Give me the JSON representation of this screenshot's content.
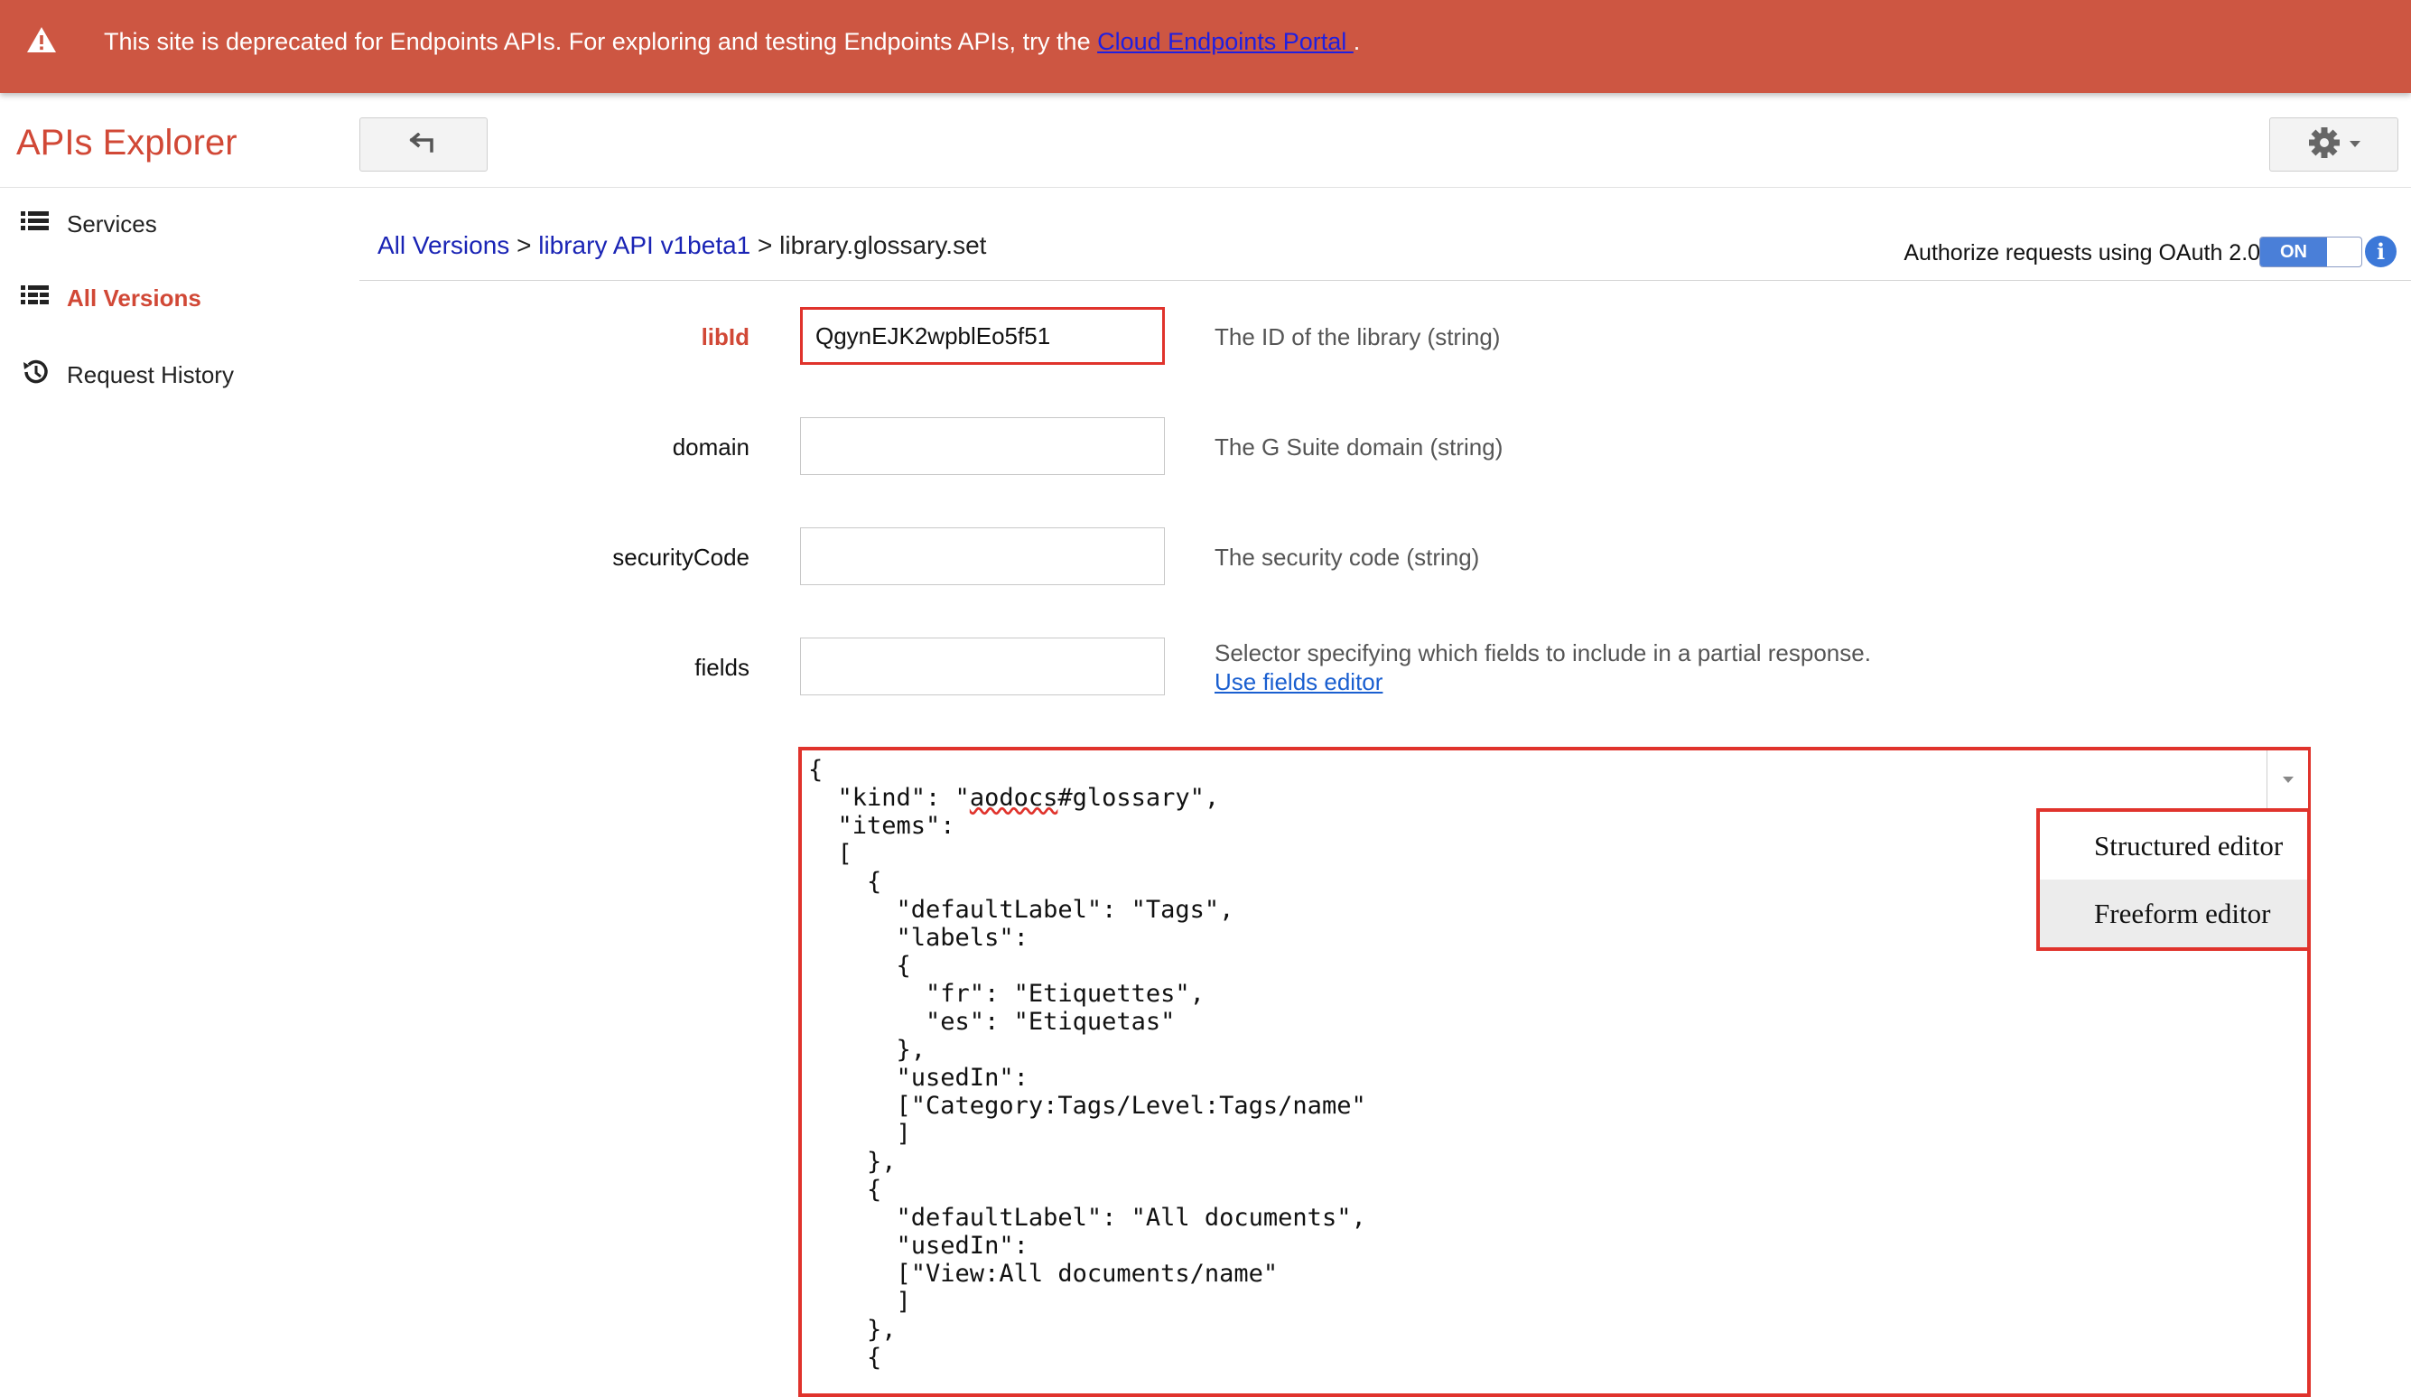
{
  "banner": {
    "message": "This site is deprecated for Endpoints APIs. For exploring and testing Endpoints APIs, try the",
    "link_text": "Cloud Endpoints Portal ",
    "trailing": ".",
    "icon": "warning-icon"
  },
  "header": {
    "title": "APIs Explorer",
    "back_icon": "back-arrow-icon",
    "settings_icon": "gear-icon"
  },
  "sidebar": {
    "items": [
      {
        "label": "Services",
        "icon": "list-icon",
        "active": false
      },
      {
        "label": "All Versions",
        "icon": "versions-list-icon",
        "active": true
      },
      {
        "label": "Request History",
        "icon": "history-icon",
        "active": false
      }
    ]
  },
  "breadcrumb": {
    "root": "All Versions",
    "sep1": ">",
    "api": "library API v1beta1",
    "sep2": ">",
    "method": "library.glossary.set"
  },
  "oauth": {
    "label": "Authorize requests using OAuth 2.0:",
    "toggle": "ON"
  },
  "form": {
    "fields": [
      {
        "label": "libId",
        "value": "QgynEJK2wpblEo5f51",
        "description": "The ID of the library (string)",
        "required": true
      },
      {
        "label": "domain",
        "value": "",
        "description": "The G Suite domain (string)",
        "required": false
      },
      {
        "label": "securityCode",
        "value": "",
        "description": "The security code (string)",
        "required": false
      },
      {
        "label": "fields",
        "value": "",
        "description": "Selector specifying which fields to include in a partial response.",
        "link": "Use fields editor",
        "required": false
      }
    ]
  },
  "body_editor": {
    "content": "{\n  \"kind\": \"aodocs#glossary\",\n  \"items\":\n  [\n    {\n      \"defaultLabel\": \"Tags\",\n      \"labels\":\n      {\n        \"fr\": \"Etiquettes\",\n        \"es\": \"Etiquetas\"\n      },\n      \"usedIn\":\n      [\"Category:Tags/Level:Tags/name\"\n      ]\n    },\n    {\n      \"defaultLabel\": \"All documents\",\n      \"usedIn\":\n      [\"View:All documents/name\"\n      ]\n    },\n    {",
    "dropdown_icon": "caret-down-icon",
    "menu": [
      "Structured editor",
      "Freeform editor"
    ],
    "selected": "Freeform editor"
  }
}
